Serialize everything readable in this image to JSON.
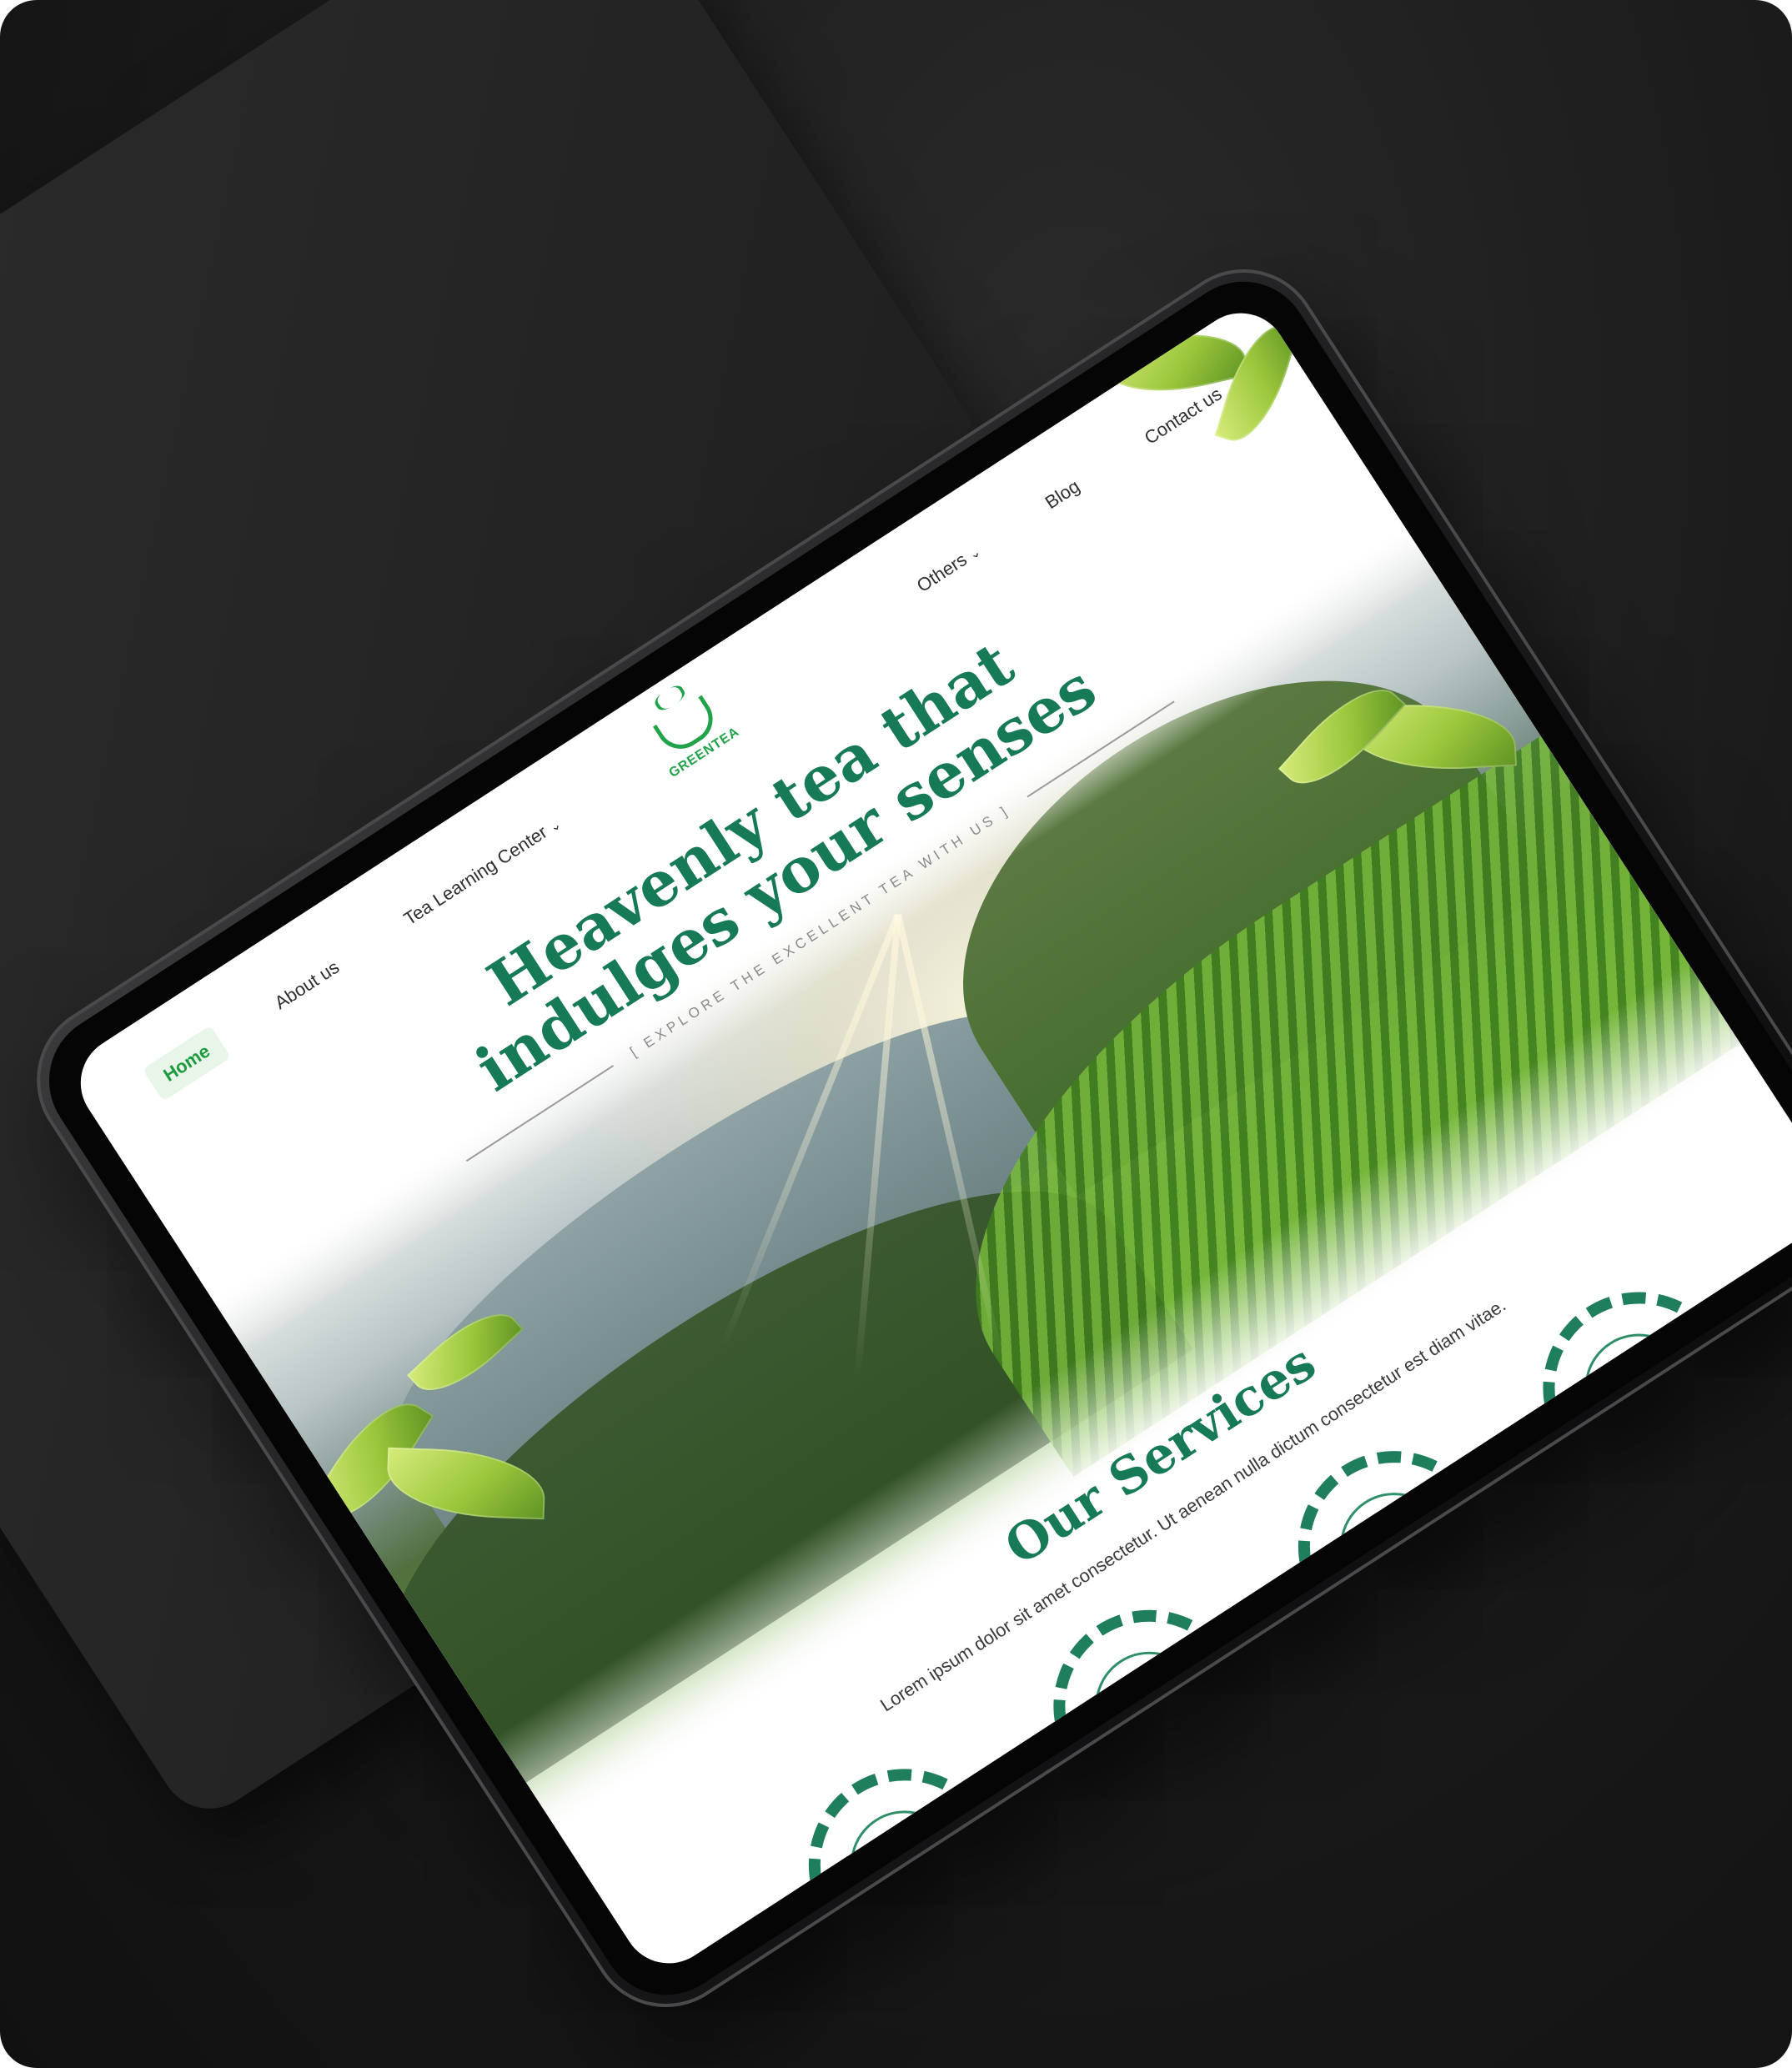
{
  "nav": {
    "items_left": [
      {
        "label": "Home",
        "active": true
      },
      {
        "label": "About us",
        "active": false
      },
      {
        "label": "Tea Learning Center",
        "active": false,
        "has_dropdown": true
      }
    ],
    "logo_text": "GREENTEA",
    "items_right": [
      {
        "label": "Others",
        "active": false,
        "has_dropdown": true
      },
      {
        "label": "Blog",
        "active": false
      },
      {
        "label": "Contact us",
        "active": false
      }
    ],
    "dropdown_icon": "chevron-down-icon"
  },
  "hero": {
    "title": "Heavenly tea that indulges your senses",
    "tagline": "[ EXPLORE THE EXCELLENT TEA WITH US ]"
  },
  "services": {
    "title": "Our Services",
    "description": "Lorem ipsum dolor sit amet consectetur. Ut aenean nulla dictum consectetur est diam vitae."
  },
  "colors": {
    "brand_green": "#157a55",
    "logo_green": "#22a24a",
    "active_nav_bg": "#e8f6e9",
    "background_dark": "#191919"
  }
}
